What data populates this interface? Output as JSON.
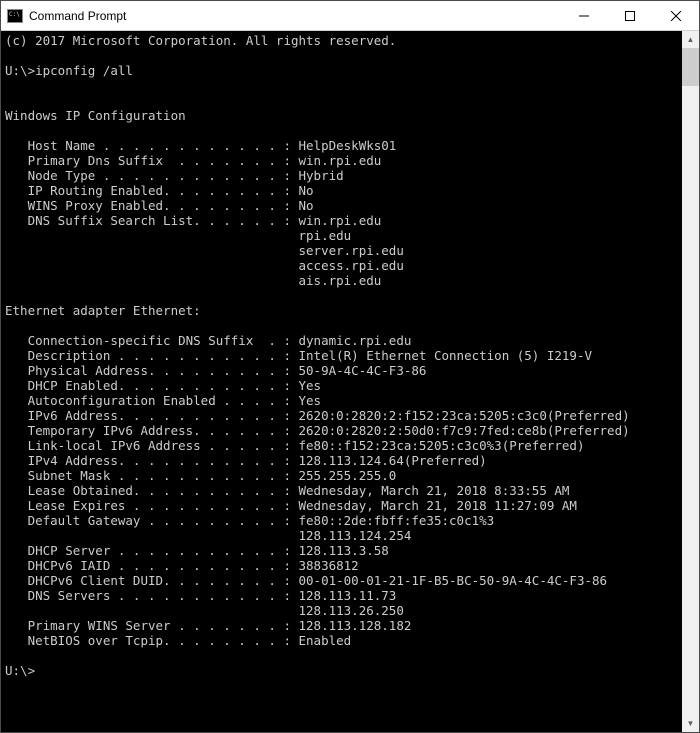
{
  "window": {
    "title": "Command Prompt"
  },
  "terminal": {
    "copyright": "(c) 2017 Microsoft Corporation. All rights reserved.",
    "prompt1": "U:\\>",
    "command1": "ipconfig /all",
    "section_ipconfig_header": "Windows IP Configuration",
    "ipconfig": {
      "host_name_label": "   Host Name . . . . . . . . . . . . : ",
      "host_name": "HelpDeskWks01",
      "primary_dns_suffix_label": "   Primary Dns Suffix  . . . . . . . : ",
      "primary_dns_suffix": "win.rpi.edu",
      "node_type_label": "   Node Type . . . . . . . . . . . . : ",
      "node_type": "Hybrid",
      "ip_routing_label": "   IP Routing Enabled. . . . . . . . : ",
      "ip_routing": "No",
      "wins_proxy_label": "   WINS Proxy Enabled. . . . . . . . : ",
      "wins_proxy": "No",
      "dns_search_label": "   DNS Suffix Search List. . . . . . : ",
      "dns_search_0": "win.rpi.edu",
      "dns_search_pad": "                                       ",
      "dns_search_1": "rpi.edu",
      "dns_search_2": "server.rpi.edu",
      "dns_search_3": "access.rpi.edu",
      "dns_search_4": "ais.rpi.edu"
    },
    "section_ethernet_header": "Ethernet adapter Ethernet:",
    "ethernet": {
      "conn_dns_label": "   Connection-specific DNS Suffix  . : ",
      "conn_dns": "dynamic.rpi.edu",
      "description_label": "   Description . . . . . . . . . . . : ",
      "description": "Intel(R) Ethernet Connection (5) I219-V",
      "phys_addr_label": "   Physical Address. . . . . . . . . : ",
      "phys_addr": "50-9A-4C-4C-F3-86",
      "dhcp_enabled_label": "   DHCP Enabled. . . . . . . . . . . : ",
      "dhcp_enabled": "Yes",
      "autoconf_label": "   Autoconfiguration Enabled . . . . : ",
      "autoconf": "Yes",
      "ipv6_label": "   IPv6 Address. . . . . . . . . . . : ",
      "ipv6": "2620:0:2820:2:f152:23ca:5205:c3c0(Preferred)",
      "tmp_ipv6_label": "   Temporary IPv6 Address. . . . . . : ",
      "tmp_ipv6": "2620:0:2820:2:50d0:f7c9:7fed:ce8b(Preferred)",
      "ll_ipv6_label": "   Link-local IPv6 Address . . . . . : ",
      "ll_ipv6": "fe80::f152:23ca:5205:c3c0%3(Preferred)",
      "ipv4_label": "   IPv4 Address. . . . . . . . . . . : ",
      "ipv4": "128.113.124.64(Preferred)",
      "subnet_label": "   Subnet Mask . . . . . . . . . . . : ",
      "subnet": "255.255.255.0",
      "lease_obt_label": "   Lease Obtained. . . . . . . . . . : ",
      "lease_obt": "Wednesday, March 21, 2018 8:33:55 AM",
      "lease_exp_label": "   Lease Expires . . . . . . . . . . : ",
      "lease_exp": "Wednesday, March 21, 2018 11:27:09 AM",
      "gateway_label": "   Default Gateway . . . . . . . . . : ",
      "gateway_0": "fe80::2de:fbff:fe35:c0c1%3",
      "gateway_pad": "                                       ",
      "gateway_1": "128.113.124.254",
      "dhcp_server_label": "   DHCP Server . . . . . . . . . . . : ",
      "dhcp_server": "128.113.3.58",
      "iaid_label": "   DHCPv6 IAID . . . . . . . . . . . : ",
      "iaid": "38836812",
      "duid_label": "   DHCPv6 Client DUID. . . . . . . . : ",
      "duid": "00-01-00-01-21-1F-B5-BC-50-9A-4C-4C-F3-86",
      "dns_servers_label": "   DNS Servers . . . . . . . . . . . : ",
      "dns_servers_0": "128.113.11.73",
      "dns_servers_pad": "                                       ",
      "dns_servers_1": "128.113.26.250",
      "wins_label": "   Primary WINS Server . . . . . . . : ",
      "wins": "128.113.128.182",
      "netbios_label": "   NetBIOS over Tcpip. . . . . . . . : ",
      "netbios": "Enabled"
    },
    "prompt2": "U:\\>"
  }
}
